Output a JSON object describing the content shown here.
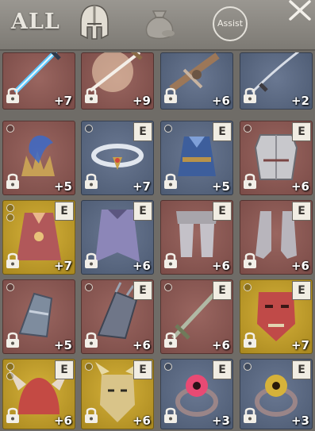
{
  "header": {
    "tab_all_label": "ALL",
    "tabs": [
      {
        "name": "helmet-icon"
      },
      {
        "name": "pouch-icon"
      }
    ],
    "assist_label": "Assist",
    "close_icon": "close-icon"
  },
  "colors": {
    "red_bg": "#8c5a55",
    "blue_bg": "#58667e",
    "gold_bg": "#c4a02c",
    "panel": "#6f6c67"
  },
  "items": [
    {
      "name": "blue-dagger",
      "bg": "red",
      "level": "+7",
      "equip": "",
      "dots": 0
    },
    {
      "name": "glowing-sword",
      "bg": "red",
      "level": "+9",
      "equip": "",
      "dots": 0
    },
    {
      "name": "crossbow",
      "bg": "blue",
      "level": "+6",
      "equip": "",
      "dots": 0
    },
    {
      "name": "katana",
      "bg": "blue",
      "level": "+2",
      "equip": "",
      "dots": 0
    },
    {
      "name": "feather-crown",
      "bg": "red",
      "level": "+5",
      "equip": "",
      "dots": 1
    },
    {
      "name": "circlet",
      "bg": "blue",
      "level": "+7",
      "equip": "E",
      "dots": 1
    },
    {
      "name": "blue-robe",
      "bg": "blue",
      "level": "+5",
      "equip": "E",
      "dots": 1
    },
    {
      "name": "plate-armor",
      "bg": "red",
      "level": "+6",
      "equip": "E",
      "dots": 1
    },
    {
      "name": "pink-robe",
      "bg": "gold",
      "level": "+7",
      "equip": "E",
      "dots": 2
    },
    {
      "name": "purple-cape",
      "bg": "blue",
      "level": "+6",
      "equip": "E",
      "dots": 0
    },
    {
      "name": "plate-legs",
      "bg": "red",
      "level": "+6",
      "equip": "E",
      "dots": 0
    },
    {
      "name": "plate-boots",
      "bg": "red",
      "level": "+6",
      "equip": "E",
      "dots": 0
    },
    {
      "name": "gauntlet",
      "bg": "red",
      "level": "+5",
      "equip": "",
      "dots": 1
    },
    {
      "name": "spiked-gauntlet",
      "bg": "red",
      "level": "+6",
      "equip": "E",
      "dots": 1
    },
    {
      "name": "green-sword",
      "bg": "red",
      "level": "+6",
      "equip": "E",
      "dots": 1
    },
    {
      "name": "red-mask",
      "bg": "gold",
      "level": "+7",
      "equip": "E",
      "dots": 1
    },
    {
      "name": "horned-helm",
      "bg": "gold",
      "level": "+6",
      "equip": "E",
      "dots": 2
    },
    {
      "name": "golden-mask",
      "bg": "gold",
      "level": "+6",
      "equip": "E",
      "dots": 1
    },
    {
      "name": "pink-eye-ring",
      "bg": "blue",
      "level": "+3",
      "equip": "E",
      "dots": 1
    },
    {
      "name": "yellow-eye-ring",
      "bg": "blue",
      "level": "+3",
      "equip": "E",
      "dots": 1
    }
  ]
}
